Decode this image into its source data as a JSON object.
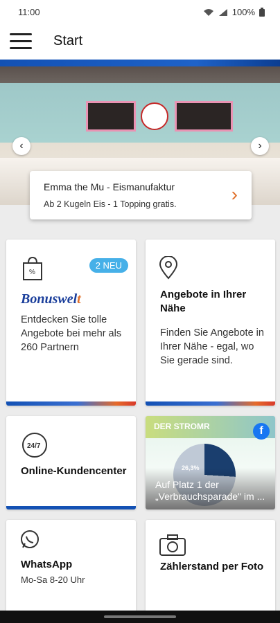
{
  "status_bar": {
    "time": "11:00",
    "battery": "100%"
  },
  "appbar": {
    "title": "Start"
  },
  "hero": {
    "promo_title": "Emma the Mu - Eismanufaktur",
    "promo_subtitle": "Ab 2 Kugeln Eis - 1 Topping gratis."
  },
  "cards": {
    "bonuswelt": {
      "badge": "2 NEU",
      "brand_main": "Bonuswel",
      "brand_tail": "t",
      "text": "Entdecken Sie tolle Angebote bei mehr als 260 Partnern"
    },
    "nearby": {
      "title": "Angebote in Ihrer Nähe",
      "text": "Finden Sie Angebote in Ihrer Nähe - egal, wo Sie gerade sind."
    },
    "online": {
      "title": "Online-Kundencenter",
      "icon_text": "24/7"
    },
    "facebook": {
      "logo": "f",
      "image_title": "DER STROMR",
      "caption": "Auf Platz 1 der „Verbrauchsparade\" im ...",
      "pie_label": "26,3%"
    },
    "whatsapp": {
      "title": "WhatsApp",
      "subtitle": "Mo-Sa 8-20 Uhr"
    },
    "meter": {
      "title": "Zählerstand per Foto"
    }
  },
  "colors": {
    "brand_blue": "#1351b4",
    "accent_orange": "#e0702a",
    "badge_blue": "#46b0e8"
  }
}
